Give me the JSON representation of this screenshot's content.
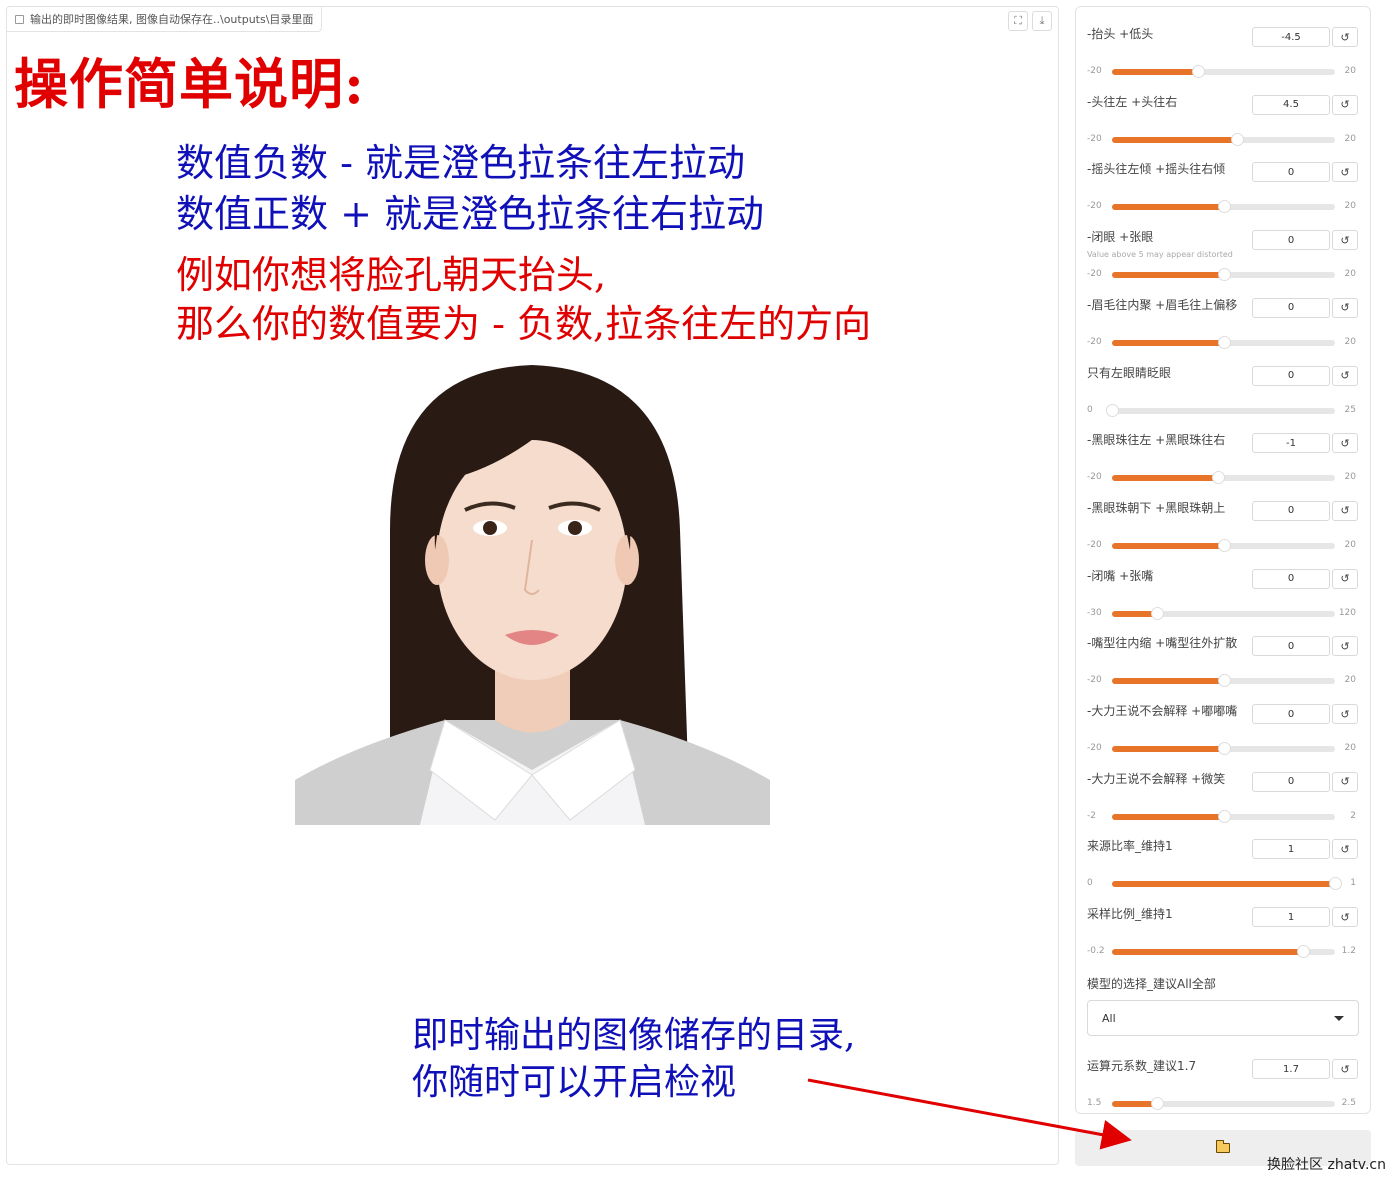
{
  "image_panel": {
    "label": "输出的即时图像结果, 图像自动保存在..\\outputs\\目录里面",
    "tools": {
      "fullscreen_glyph": "⛶",
      "download_glyph": "⤓"
    }
  },
  "annotations": {
    "title": "操作简单说明:",
    "line1": "数值负数 - 就是澄色拉条往左拉动",
    "line2": "数值正数 + 就是澄色拉条往右拉动",
    "line3": "例如你想将脸孔朝天抬头,",
    "line4": "那么你的数值要为 - 负数,拉条往左的方向",
    "line5": "即时输出的图像储存的目录,",
    "line6": "你随时可以开启检视"
  },
  "sliders": [
    {
      "label": "-抬头 +低头",
      "value": "-4.5",
      "min": "-20",
      "max": "20",
      "fraction": 0.3875
    },
    {
      "label": "-头往左 +头往右",
      "value": "4.5",
      "min": "-20",
      "max": "20",
      "fraction": 0.5625
    },
    {
      "label": "-摇头往左倾 +摇头往右倾",
      "value": "0",
      "min": "-20",
      "max": "20",
      "fraction": 0.5
    },
    {
      "label": "-闭眼 +张眼",
      "info": "Value above 5 may appear distorted",
      "value": "0",
      "min": "-20",
      "max": "20",
      "fraction": 0.5
    },
    {
      "label": "-眉毛往内聚 +眉毛往上偏移",
      "value": "0",
      "min": "-20",
      "max": "20",
      "fraction": 0.5
    },
    {
      "label": "只有左眼睛眨眼",
      "value": "0",
      "min": "0",
      "max": "25",
      "fraction": 0.0
    },
    {
      "label": "-黑眼珠往左 +黑眼珠往右",
      "value": "-1",
      "min": "-20",
      "max": "20",
      "fraction": 0.475
    },
    {
      "label": "-黑眼珠朝下 +黑眼珠朝上",
      "value": "0",
      "min": "-20",
      "max": "20",
      "fraction": 0.5
    },
    {
      "label": "-闭嘴 +张嘴",
      "value": "0",
      "min": "-30",
      "max": "120",
      "fraction": 0.2
    },
    {
      "label": "-嘴型往内缩 +嘴型往外扩散",
      "value": "0",
      "min": "-20",
      "max": "20",
      "fraction": 0.5
    },
    {
      "label": "-大力王说不会解释 +嘟嘟嘴",
      "value": "0",
      "min": "-20",
      "max": "20",
      "fraction": 0.5
    },
    {
      "label": "-大力王说不会解释 +微笑",
      "value": "0",
      "min": "-2",
      "max": "2",
      "fraction": 0.5
    },
    {
      "label": "来源比率_维持1",
      "value": "1",
      "min": "0",
      "max": "1",
      "fraction": 1.0
    },
    {
      "label": "采样比例_维持1",
      "value": "1",
      "min": "-0.2",
      "max": "1.2",
      "fraction": 0.857
    }
  ],
  "model_select": {
    "label": "模型的选择_建议All全部",
    "value": "All"
  },
  "last_slider": {
    "label": "运算元系数_建议1.7",
    "value": "1.7",
    "min": "1.5",
    "max": "2.5",
    "fraction": 0.2
  },
  "reset_glyph": "↺",
  "colors": {
    "accent": "#e8742a",
    "annotation_red": "#e00000",
    "annotation_blue": "#1010b8"
  },
  "watermark": "换脸社区 zhatv.cn"
}
